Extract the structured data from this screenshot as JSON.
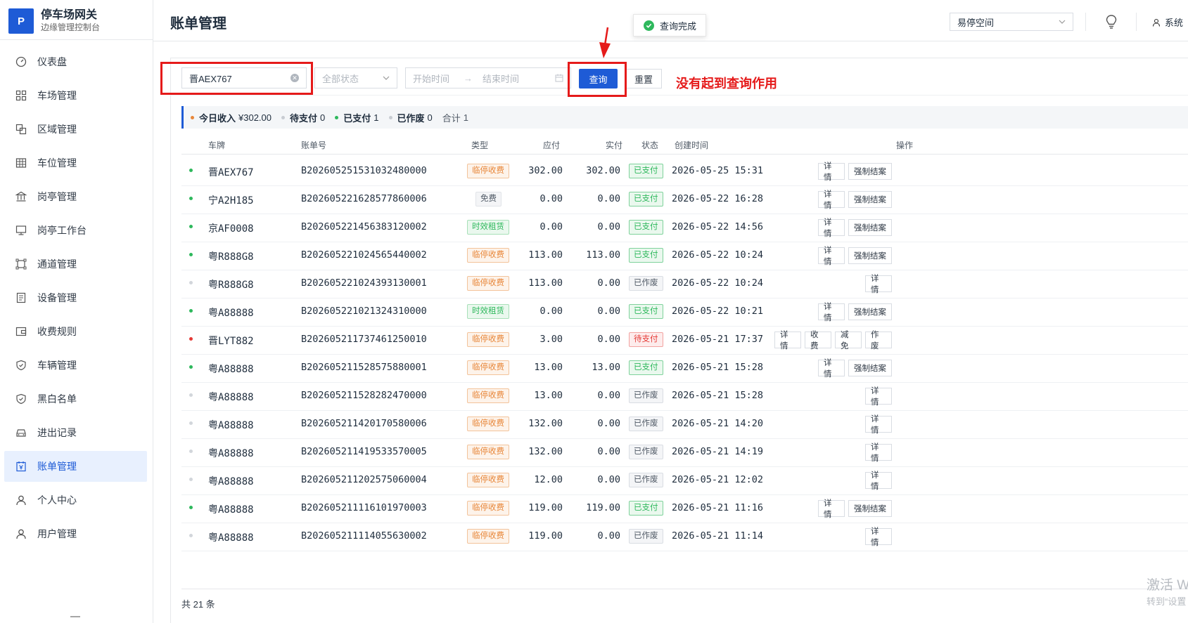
{
  "brand": {
    "logo": "P",
    "title": "停车场网关",
    "subtitle": "边缘管理控制台"
  },
  "nav": [
    {
      "label": "仪表盘",
      "icon": "dashboard-icon"
    },
    {
      "label": "车场管理",
      "icon": "grid-icon"
    },
    {
      "label": "区域管理",
      "icon": "area-icon"
    },
    {
      "label": "车位管理",
      "icon": "table-icon"
    },
    {
      "label": "岗亭管理",
      "icon": "bank-icon"
    },
    {
      "label": "岗亭工作台",
      "icon": "monitor-icon"
    },
    {
      "label": "通道管理",
      "icon": "channel-icon"
    },
    {
      "label": "设备管理",
      "icon": "device-icon"
    },
    {
      "label": "收费规则",
      "icon": "wallet-icon"
    },
    {
      "label": "车辆管理",
      "icon": "shield-icon"
    },
    {
      "label": "黑白名单",
      "icon": "shield-check-icon"
    },
    {
      "label": "进出记录",
      "icon": "car-icon"
    },
    {
      "label": "账单管理",
      "icon": "bill-icon",
      "active": true
    },
    {
      "label": "个人中心",
      "icon": "user-icon"
    },
    {
      "label": "用户管理",
      "icon": "user-icon"
    }
  ],
  "header": {
    "title": "账单管理",
    "space": "易停空间",
    "user": "系统"
  },
  "toast": {
    "text": "查询完成"
  },
  "filter": {
    "plate_value": "晋AEX767",
    "status_placeholder": "全部状态",
    "start_placeholder": "开始时间",
    "end_placeholder": "结束时间",
    "query_label": "查询",
    "reset_label": "重置"
  },
  "annotation": "没有起到查询作用",
  "summary": {
    "income_label": "今日收入",
    "income_value": "¥302.00",
    "pending_label": "待支付",
    "pending_value": "0",
    "paid_label": "已支付",
    "paid_value": "1",
    "void_label": "已作废",
    "void_value": "0",
    "total_label": "合计",
    "total_value": "1"
  },
  "columns": [
    "车牌",
    "账单号",
    "类型",
    "应付",
    "实付",
    "状态",
    "创建时间",
    "操作"
  ],
  "rows": [
    {
      "plate": "晋AEX767",
      "bill": "B202605251531032480000",
      "type": "临停收费",
      "due": "302.00",
      "paid": "302.00",
      "status": "已支付",
      "time": "2026-05-25 15:31",
      "ops": [
        "详情",
        "强制结案"
      ]
    },
    {
      "plate": "宁A2H185",
      "bill": "B202605221628577860006",
      "type": "免费",
      "due": "0.00",
      "paid": "0.00",
      "status": "已支付",
      "time": "2026-05-22 16:28",
      "ops": [
        "详情",
        "强制结案"
      ]
    },
    {
      "plate": "京AF0008",
      "bill": "B202605221456383120002",
      "type": "时效租赁",
      "due": "0.00",
      "paid": "0.00",
      "status": "已支付",
      "time": "2026-05-22 14:56",
      "ops": [
        "详情",
        "强制结案"
      ]
    },
    {
      "plate": "粤R888G8",
      "bill": "B202605221024565440002",
      "type": "临停收费",
      "due": "113.00",
      "paid": "113.00",
      "status": "已支付",
      "time": "2026-05-22 10:24",
      "ops": [
        "详情",
        "强制结案"
      ]
    },
    {
      "plate": "粤R888G8",
      "bill": "B202605221024393130001",
      "type": "临停收费",
      "due": "113.00",
      "paid": "0.00",
      "status": "已作废",
      "time": "2026-05-22 10:24",
      "ops": [
        "详情"
      ]
    },
    {
      "plate": "粤A88888",
      "bill": "B202605221021324310000",
      "type": "时效租赁",
      "due": "0.00",
      "paid": "0.00",
      "status": "已支付",
      "time": "2026-05-22 10:21",
      "ops": [
        "详情",
        "强制结案"
      ]
    },
    {
      "plate": "晋LYT882",
      "bill": "B202605211737461250010",
      "type": "临停收费",
      "due": "3.00",
      "paid": "0.00",
      "status": "待支付",
      "time": "2026-05-21 17:37",
      "ops": [
        "详情",
        "收费",
        "减免",
        "作废"
      ]
    },
    {
      "plate": "粤A88888",
      "bill": "B202605211528575880001",
      "type": "临停收费",
      "due": "13.00",
      "paid": "13.00",
      "status": "已支付",
      "time": "2026-05-21 15:28",
      "ops": [
        "详情",
        "强制结案"
      ]
    },
    {
      "plate": "粤A88888",
      "bill": "B202605211528282470000",
      "type": "临停收费",
      "due": "13.00",
      "paid": "0.00",
      "status": "已作废",
      "time": "2026-05-21 15:28",
      "ops": [
        "详情"
      ]
    },
    {
      "plate": "粤A88888",
      "bill": "B202605211420170580006",
      "type": "临停收费",
      "due": "132.00",
      "paid": "0.00",
      "status": "已作废",
      "time": "2026-05-21 14:20",
      "ops": [
        "详情"
      ]
    },
    {
      "plate": "粤A88888",
      "bill": "B202605211419533570005",
      "type": "临停收费",
      "due": "132.00",
      "paid": "0.00",
      "status": "已作废",
      "time": "2026-05-21 14:19",
      "ops": [
        "详情"
      ]
    },
    {
      "plate": "粤A88888",
      "bill": "B202605211202575060004",
      "type": "临停收费",
      "due": "12.00",
      "paid": "0.00",
      "status": "已作废",
      "time": "2026-05-21 12:02",
      "ops": [
        "详情"
      ]
    },
    {
      "plate": "粤A88888",
      "bill": "B202605211116101970003",
      "type": "临停收费",
      "due": "119.00",
      "paid": "119.00",
      "status": "已支付",
      "time": "2026-05-21 11:16",
      "ops": [
        "详情",
        "强制结案"
      ]
    },
    {
      "plate": "粤A88888",
      "bill": "B202605211114055630002",
      "type": "临停收费",
      "due": "119.00",
      "paid": "0.00",
      "status": "已作废",
      "time": "2026-05-21 11:14",
      "ops": [
        "详情"
      ]
    }
  ],
  "footer": {
    "total": "共 21 条"
  },
  "watermark": {
    "line1": "激活 W",
    "line2": "转到“设置"
  },
  "colors": {
    "primary": "#1e5bd6",
    "paid_green": "#2eb85c",
    "pending_red": "#e53935",
    "void_gray": "#c8ccd2",
    "annotation_red": "#e51a1a",
    "tag_orange": "#e8873a",
    "tag_green": "#2eb85c"
  }
}
